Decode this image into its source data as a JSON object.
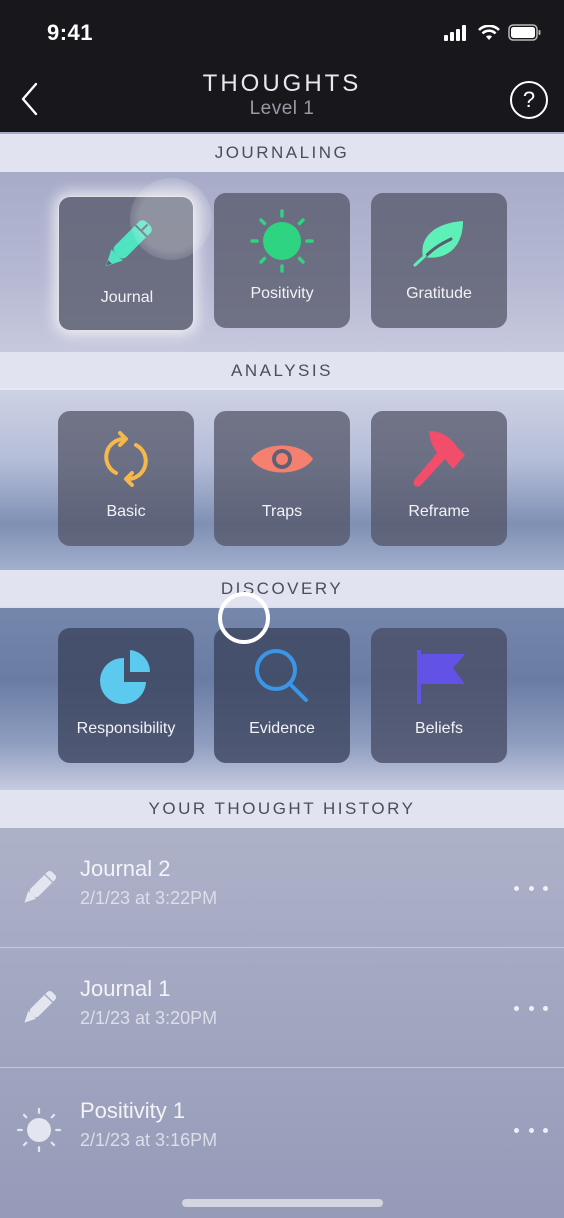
{
  "status_bar": {
    "time": "9:41",
    "icons": [
      "signal-icon",
      "wifi-icon",
      "battery-icon"
    ]
  },
  "nav": {
    "title": "THOUGHTS",
    "subtitle": "Level 1",
    "back_icon": "chevron-left-icon",
    "help_icon": "question-circle-icon",
    "help_glyph": "?"
  },
  "sections": [
    {
      "title": "JOURNALING",
      "tiles": [
        {
          "label": "Journal",
          "icon": "pencil-icon",
          "color": "#4fe3c1",
          "pressed": true
        },
        {
          "label": "Positivity",
          "icon": "sun-icon",
          "color": "#2ed47f"
        },
        {
          "label": "Gratitude",
          "icon": "leaf-icon",
          "color": "#5ff0b8"
        }
      ]
    },
    {
      "title": "ANALYSIS",
      "tiles": [
        {
          "label": "Basic",
          "icon": "refresh-cycle-icon",
          "color": "#f5b84a"
        },
        {
          "label": "Traps",
          "icon": "eye-icon",
          "color": "#f5806f"
        },
        {
          "label": "Reframe",
          "icon": "hammer-icon",
          "color": "#f24d6b"
        }
      ]
    },
    {
      "title": "DISCOVERY",
      "tiles": [
        {
          "label": "Responsibility",
          "icon": "pie-chart-icon",
          "color": "#5cc9ef"
        },
        {
          "label": "Evidence",
          "icon": "magnifier-icon",
          "color": "#3c96e8"
        },
        {
          "label": "Beliefs",
          "icon": "flag-icon",
          "color": "#6352e6"
        }
      ]
    }
  ],
  "history": {
    "title": "YOUR THOUGHT HISTORY",
    "items": [
      {
        "title": "Journal 2",
        "date": "2/1/23 at 3:22PM",
        "icon": "pencil-icon"
      },
      {
        "title": "Journal 1",
        "date": "2/1/23 at 3:20PM",
        "icon": "pencil-icon"
      },
      {
        "title": "Positivity 1",
        "date": "2/1/23 at 3:16PM",
        "icon": "sun-icon"
      }
    ]
  }
}
